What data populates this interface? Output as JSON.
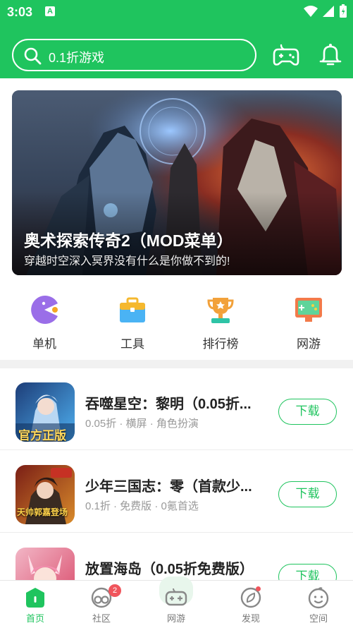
{
  "status_bar": {
    "time": "3:03",
    "notice_letter": "A"
  },
  "header": {
    "search_placeholder": "0.1折游戏",
    "icons": [
      "search-icon",
      "gamepad-icon",
      "bell-icon"
    ],
    "accent_color": "#1fc45e"
  },
  "banner": {
    "title": "奥术探索传奇2（MOD菜单）",
    "subtitle": "穿越时空深入冥界没有什么是你做不到的!"
  },
  "categories": [
    {
      "label": "单机",
      "icon": "pacman-icon"
    },
    {
      "label": "工具",
      "icon": "toolbox-icon"
    },
    {
      "label": "排行榜",
      "icon": "trophy-icon"
    },
    {
      "label": "网游",
      "icon": "game-screen-icon"
    }
  ],
  "games": [
    {
      "name": "吞噬星空：黎明（0.05折...",
      "meta": "0.05折 · 横屏 · 角色扮演",
      "button": "下载",
      "thumb_text": "官方正版"
    },
    {
      "name": "少年三国志：零（首款少...",
      "meta": "0.1折 · 免费版 · 0氪首选",
      "button": "下载",
      "thumb_text": "天帅郭嘉登场"
    },
    {
      "name": "放置海岛（0.05折免费版）",
      "meta": "",
      "button": "下载",
      "thumb_text": ""
    }
  ],
  "tabs": [
    {
      "label": "首页",
      "active": true
    },
    {
      "label": "社区",
      "active": false,
      "badge": "2"
    },
    {
      "label": "网游",
      "active": false
    },
    {
      "label": "发现",
      "active": false
    },
    {
      "label": "空间",
      "active": false
    }
  ]
}
